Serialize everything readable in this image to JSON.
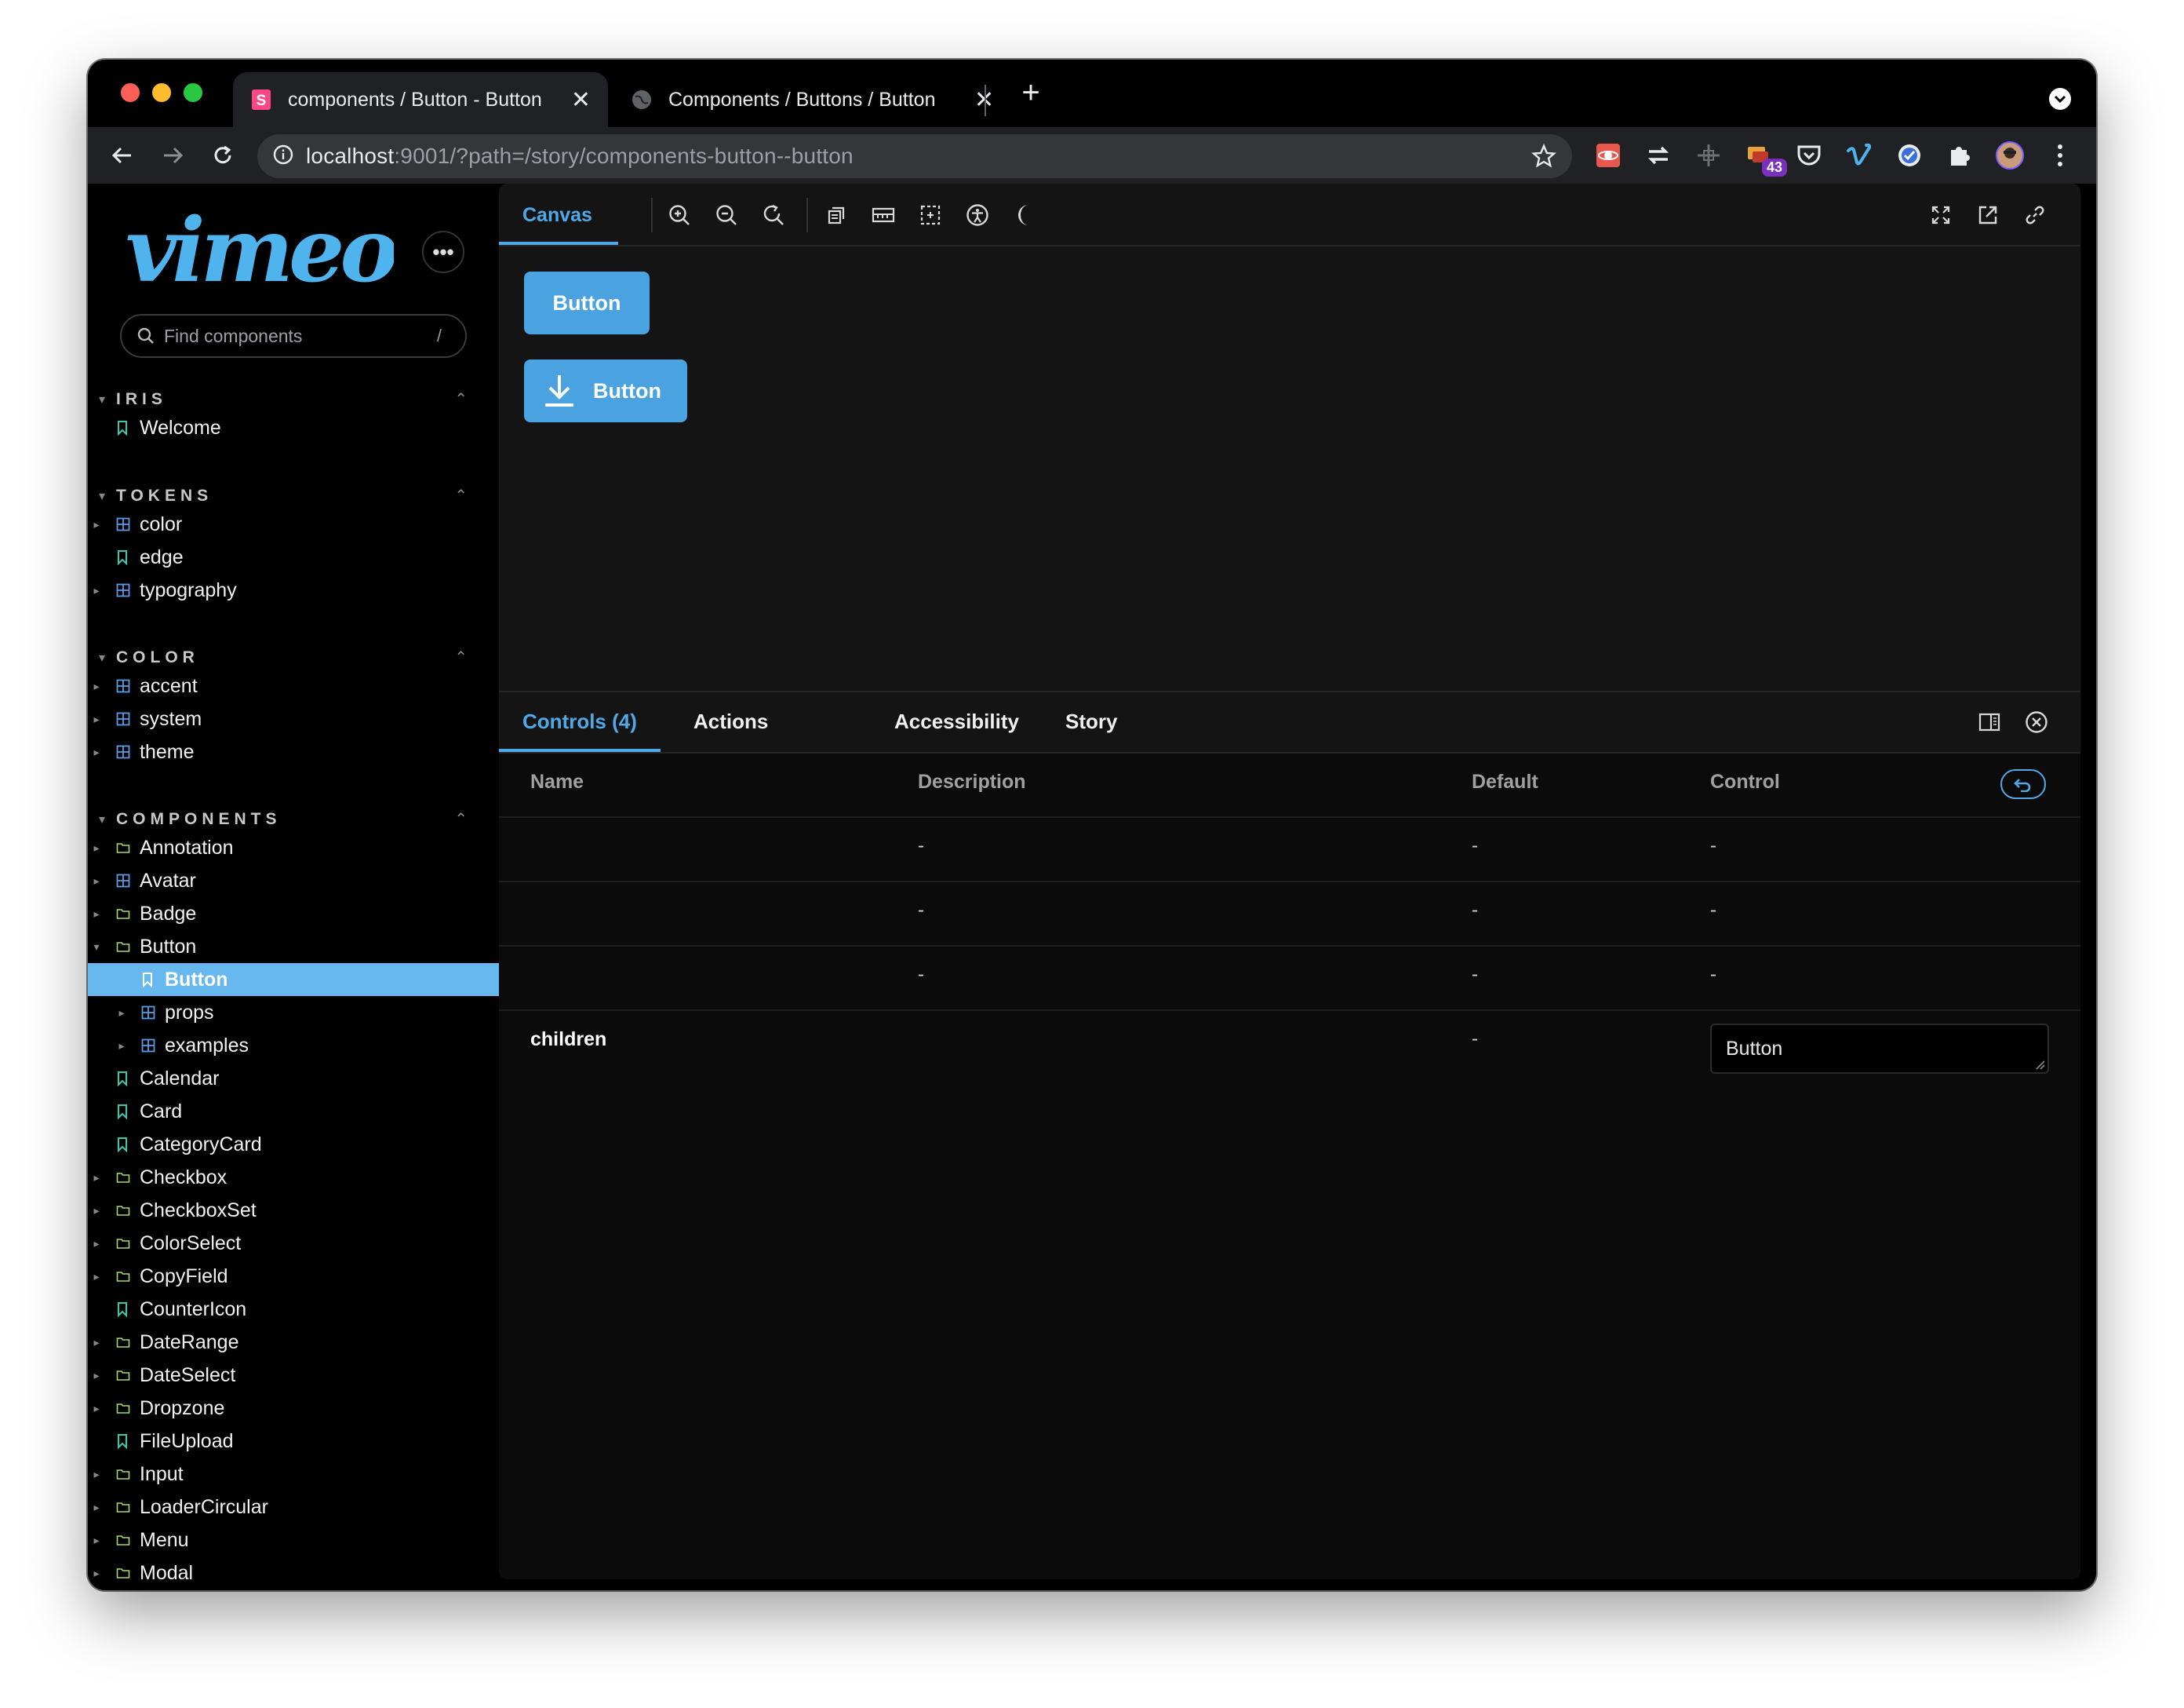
{
  "browser": {
    "tabs": [
      {
        "title": "components / Button - Button",
        "close": "✕"
      },
      {
        "title": "Components / Buttons / Button",
        "close": "✕"
      }
    ],
    "new_tab": "+",
    "url_host": "localhost",
    "url_rest": ":9001/?path=/story/components-button--button",
    "extension_badge": "43"
  },
  "sidebar": {
    "search_placeholder": "Find components",
    "search_shortcut": "/",
    "more": "•••",
    "sections": {
      "iris": "IRIS",
      "tokens": "TOKENS",
      "color": "COLOR",
      "components": "COMPONENTS"
    },
    "iris_items": [
      "Welcome"
    ],
    "tokens_items": [
      "color",
      "edge",
      "typography"
    ],
    "color_items": [
      "accent",
      "system",
      "theme"
    ],
    "components_items": [
      "Annotation",
      "Avatar",
      "Badge",
      "Button",
      "Button",
      "props",
      "examples",
      "Calendar",
      "Card",
      "CategoryCard",
      "Checkbox",
      "CheckboxSet",
      "ColorSelect",
      "CopyField",
      "CounterIcon",
      "DateRange",
      "DateSelect",
      "Dropzone",
      "FileUpload",
      "Input",
      "LoaderCircular",
      "Menu",
      "Modal"
    ]
  },
  "canvas": {
    "tab_label": "Canvas",
    "button1_label": "Button",
    "button2_label": "Button"
  },
  "addons": {
    "tabs": [
      "Controls (4)",
      "Actions",
      "Accessibility",
      "Story"
    ]
  },
  "controls_table": {
    "headers": {
      "name": "Name",
      "description": "Description",
      "default": "Default",
      "control": "Control"
    },
    "rows": [
      {
        "name": "",
        "description": "-",
        "default": "-",
        "control": "-"
      },
      {
        "name": "",
        "description": "-",
        "default": "-",
        "control": "-"
      },
      {
        "name": "",
        "description": "-",
        "default": "-",
        "control": "-"
      },
      {
        "name": "children",
        "description": "",
        "default": "-",
        "control_value": "Button"
      }
    ]
  },
  "colors": {
    "accent": "#4fa9e8",
    "selected_item": "#66b8ee",
    "button": "#4aa3e0",
    "logo": "#4fb3ee"
  }
}
